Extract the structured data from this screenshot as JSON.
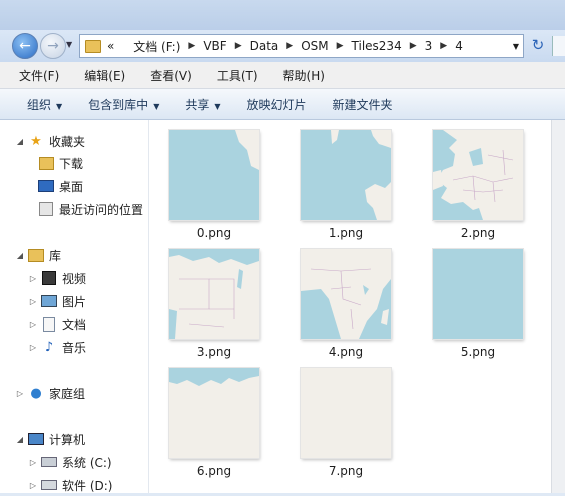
{
  "address": {
    "prefix": "«",
    "crumbs": [
      "文档 (F:)",
      "VBF",
      "Data",
      "OSM",
      "Tiles234",
      "3",
      "4"
    ]
  },
  "menu": [
    "文件(F)",
    "编辑(E)",
    "查看(V)",
    "工具(T)",
    "帮助(H)"
  ],
  "commands": [
    {
      "label": "组织",
      "dropdown": true
    },
    {
      "label": "包含到库中",
      "dropdown": true
    },
    {
      "label": "共享",
      "dropdown": true
    },
    {
      "label": "放映幻灯片",
      "dropdown": false
    },
    {
      "label": "新建文件夹",
      "dropdown": false
    }
  ],
  "nav": {
    "favorites": {
      "label": "收藏夹",
      "icon": "star-icon",
      "items": [
        {
          "label": "下载",
          "icon": "downloads-folder-icon"
        },
        {
          "label": "桌面",
          "icon": "desktop-icon"
        },
        {
          "label": "最近访问的位置",
          "icon": "recent-places-icon"
        }
      ]
    },
    "libraries": {
      "label": "库",
      "icon": "library-icon",
      "items": [
        {
          "label": "视频",
          "icon": "videos-icon"
        },
        {
          "label": "图片",
          "icon": "pictures-icon"
        },
        {
          "label": "文档",
          "icon": "documents-icon"
        },
        {
          "label": "音乐",
          "icon": "music-icon"
        }
      ]
    },
    "homegroup": {
      "label": "家庭组",
      "icon": "homegroup-icon"
    },
    "computer": {
      "label": "计算机",
      "icon": "computer-icon",
      "items": [
        {
          "label": "系统 (C:)",
          "icon": "system-drive-icon"
        },
        {
          "label": "软件 (D:)",
          "icon": "drive-icon"
        }
      ]
    }
  },
  "files": [
    {
      "name": "0.png",
      "tile": "ocean-with-land-corner"
    },
    {
      "name": "1.png",
      "tile": "scandinavia-and-africa-coast"
    },
    {
      "name": "2.png",
      "tile": "europe"
    },
    {
      "name": "3.png",
      "tile": "north-africa"
    },
    {
      "name": "4.png",
      "tile": "central-africa"
    },
    {
      "name": "5.png",
      "tile": "ocean"
    },
    {
      "name": "6.png",
      "tile": "antarctica-coast"
    },
    {
      "name": "7.png",
      "tile": "antarctica"
    }
  ],
  "colors": {
    "water": "#aad3df",
    "land": "#f2efe9",
    "accent": "#1e395b"
  }
}
